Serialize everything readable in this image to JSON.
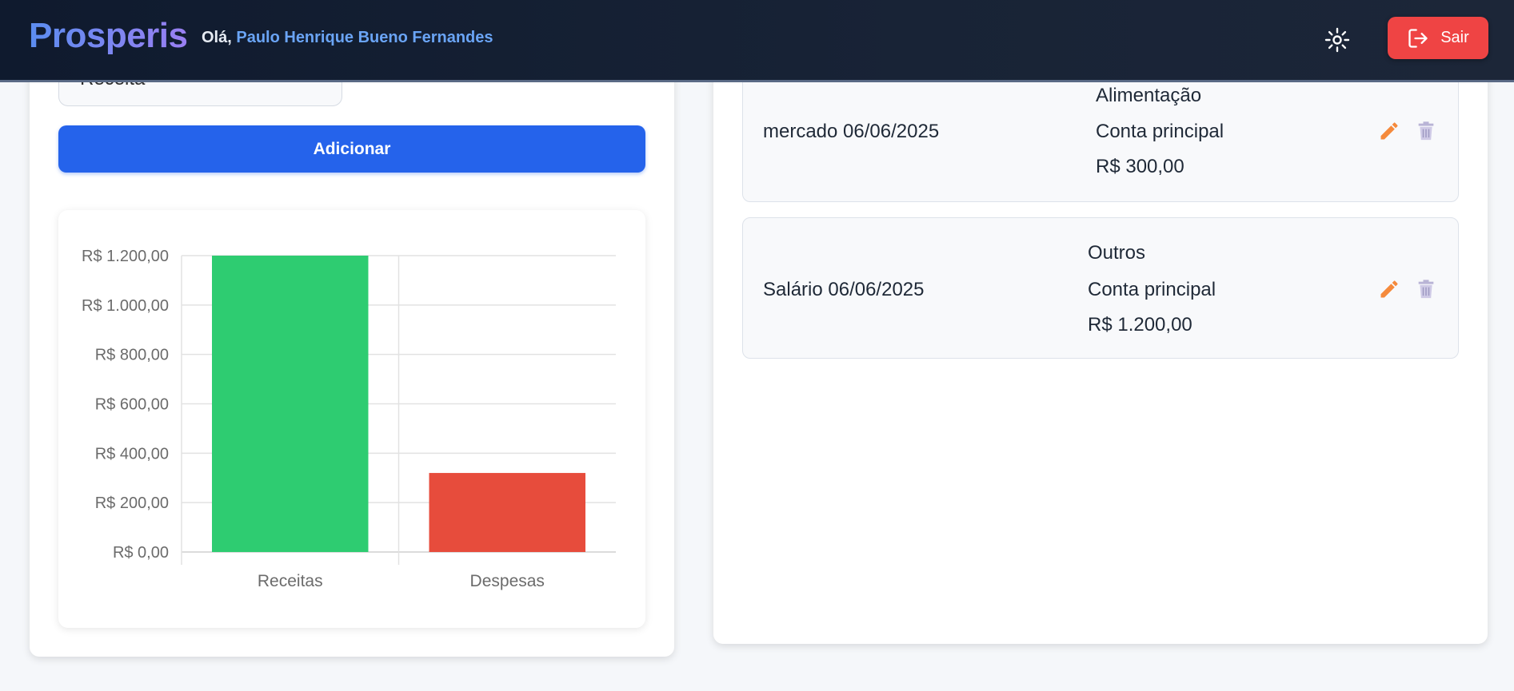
{
  "header": {
    "brand": "Prosperis",
    "greeting": "Olá,",
    "user_name": "Paulo Henrique Bueno Fernandes",
    "theme_icon": "sun-icon",
    "logout_icon": "logout-icon",
    "logout_label": "Sair"
  },
  "form": {
    "type_value": "Receita",
    "add_label": "Adicionar"
  },
  "chart_data": {
    "type": "bar",
    "categories": [
      "Receitas",
      "Despesas"
    ],
    "values": [
      1200,
      320
    ],
    "colors": [
      "#2ecc71",
      "#e74c3c"
    ],
    "ylim": [
      0,
      1200
    ],
    "yticks": [
      "R$ 0,00",
      "R$ 200,00",
      "R$ 400,00",
      "R$ 600,00",
      "R$ 800,00",
      "R$ 1.000,00",
      "R$ 1.200,00"
    ],
    "grid": true
  },
  "transactions": [
    {
      "description": "mercado 06/06/2025",
      "category": "Alimentação",
      "account": "Conta principal",
      "amount": "R$ 300,00",
      "edit_icon": "pencil-icon",
      "delete_icon": "trash-icon"
    },
    {
      "description": "Salário 06/06/2025",
      "category": "Outros",
      "account": "Conta principal",
      "amount": "R$ 1.200,00",
      "edit_icon": "pencil-icon",
      "delete_icon": "trash-icon"
    }
  ],
  "colors": {
    "primary": "#2563eb",
    "danger": "#ef4444",
    "edit": "#f58a3c",
    "delete": "#b9b4d6"
  }
}
